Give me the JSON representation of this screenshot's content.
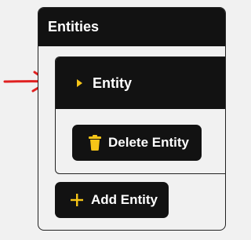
{
  "panel": {
    "title": "Entities"
  },
  "entity": {
    "title": "Entity",
    "expanded": false,
    "delete_label": "Delete Entity"
  },
  "add_label": "Add Entity",
  "colors": {
    "header_bg": "#121212",
    "panel_bg": "#f1f1f1",
    "accent": "#f5c518",
    "annotation_arrow": "#e02020",
    "text_on_dark": "#ffffff"
  },
  "icons": {
    "caret": "caret-right-icon",
    "delete": "trash-icon",
    "add": "plus-icon",
    "annotation": "red-arrow-annotation"
  }
}
